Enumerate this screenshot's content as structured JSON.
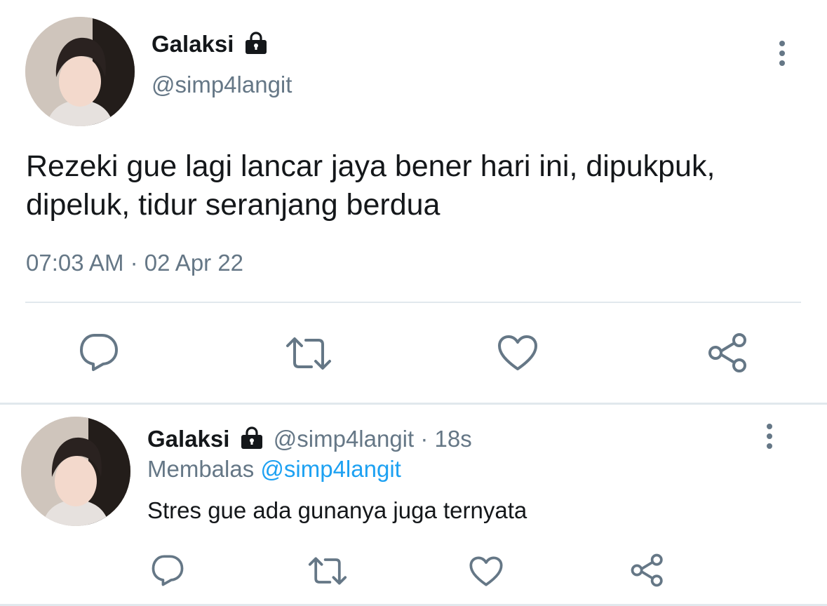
{
  "main_tweet": {
    "display_name": "Galaksi",
    "handle": "@simp4langit",
    "text_line1": "Rezeki gue lagi lancar jaya bener hari ini, dipukpuk,",
    "text_line2": "dipeluk, tidur seranjang berdua",
    "timestamp": "07:03 AM · 02 Apr 22",
    "icons": [
      "lock-icon",
      "more-vert-icon",
      "reply-icon",
      "retweet-icon",
      "like-icon",
      "share-icon"
    ]
  },
  "reply_tweet": {
    "display_name": "Galaksi",
    "handle_time": "@simp4langit · 18s",
    "replying_label": "Membalas",
    "replying_to": "@simp4langit",
    "text": "Stres gue ada gunanya juga ternyata",
    "icons": [
      "lock-icon",
      "more-vert-icon",
      "reply-icon",
      "retweet-icon",
      "like-icon",
      "share-icon"
    ]
  },
  "colors": {
    "text": "#14171a",
    "muted": "#657786",
    "link": "#1da1f2",
    "divider": "#e1e8ed"
  }
}
